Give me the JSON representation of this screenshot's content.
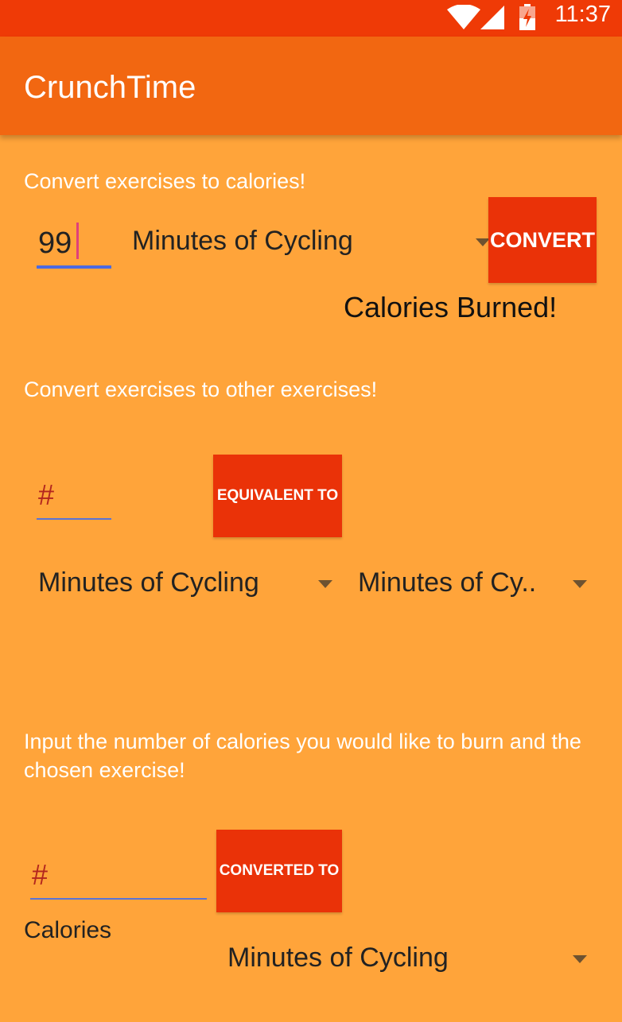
{
  "status_bar": {
    "time": "11:37",
    "wifi_icon": "wifi-icon",
    "signal_icon": "cell-signal-icon",
    "battery_icon": "battery-charging-icon"
  },
  "app_bar": {
    "title": "CrunchTime"
  },
  "section1": {
    "label": "Convert exercises to calories!",
    "amount_value": "99",
    "exercise": "Minutes of Cycling",
    "convert_label": "CONVERT",
    "result_label": "Calories Burned!"
  },
  "section2": {
    "label": "Convert exercises to other exercises!",
    "amount_placeholder": "#",
    "equivalent_label": "EQUIVALENT TO",
    "from_exercise": "Minutes of Cycling",
    "to_exercise": "Minutes of Cy.."
  },
  "section3": {
    "label": "Input the number of calories you would like to burn and the chosen exercise!",
    "calories_placeholder": "#",
    "converted_label": "CONVERTED TO",
    "calories_caption": "Calories",
    "exercise": "Minutes of Cycling"
  },
  "colors": {
    "status_bar": "#EF3A06",
    "app_bar": "#F26711",
    "background": "#FFA43A",
    "button": "#EA3208"
  }
}
